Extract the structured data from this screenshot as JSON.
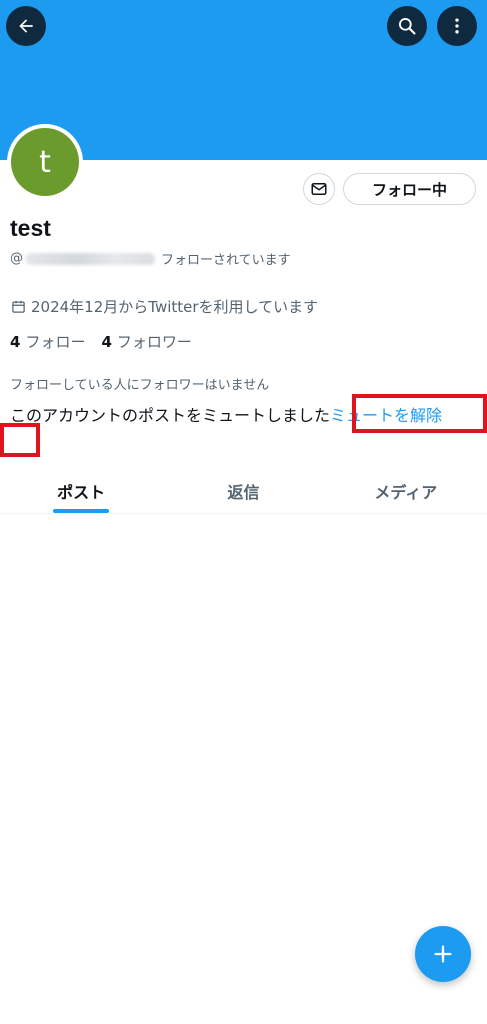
{
  "header": {
    "back_icon": "arrow-left-icon",
    "search_icon": "search-icon",
    "more_icon": "more-vertical-icon",
    "banner_color": "#1d9bf0"
  },
  "profile": {
    "avatar_letter": "t",
    "avatar_color": "#6b9a2d",
    "display_name": "test",
    "handle_prefix": "@",
    "follows_you": "フォローされています",
    "joined": "2024年12月からTwitterを利用しています",
    "following_count": "4",
    "following_label": "フォロー",
    "followers_count": "4",
    "followers_label": "フォロワー",
    "no_followers_note": "フォローしている人にフォロワーはいません",
    "muted_text": "このアカウントのポストをミュートしました",
    "unmute_link": "ミュートを解除"
  },
  "actions": {
    "message_icon": "mail-icon",
    "follow_label": "フォロー中"
  },
  "tabs": [
    {
      "label": "ポスト",
      "active": true
    },
    {
      "label": "返信",
      "active": false
    },
    {
      "label": "メディア",
      "active": false
    }
  ],
  "fab": {
    "icon": "plus-icon"
  },
  "colors": {
    "accent": "#1d9bf0",
    "highlight": "#e0141e"
  }
}
